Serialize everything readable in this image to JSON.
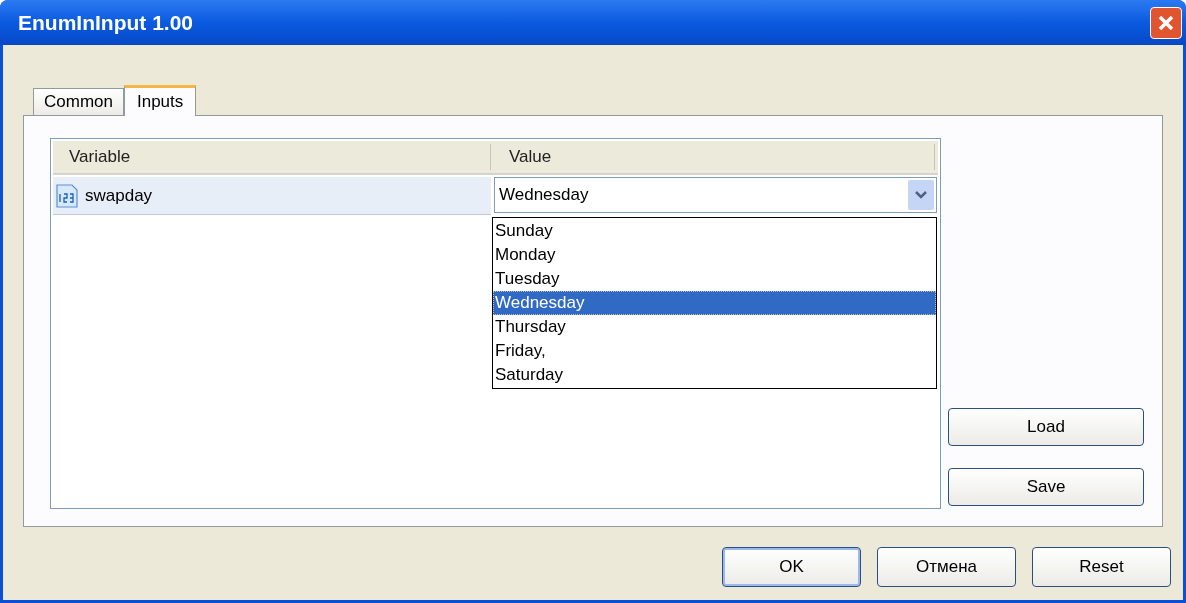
{
  "window": {
    "title": "EnumInInput 1.00"
  },
  "tabs": [
    {
      "label": "Common",
      "selected": false
    },
    {
      "label": "Inputs",
      "selected": true
    }
  ],
  "table": {
    "columns": [
      "Variable",
      "Value"
    ],
    "rows": [
      {
        "variable": "swapday",
        "value": "Wednesday",
        "expanded": true
      }
    ]
  },
  "dropdown": {
    "options": [
      {
        "label": "Sunday",
        "selected": false
      },
      {
        "label": "Monday",
        "selected": false
      },
      {
        "label": "Tuesday",
        "selected": false
      },
      {
        "label": "Wednesday",
        "selected": true
      },
      {
        "label": "Thursday",
        "selected": false
      },
      {
        "label": "Friday,",
        "selected": false
      },
      {
        "label": "Saturday",
        "selected": false
      }
    ]
  },
  "side_buttons": [
    "Load",
    "Save"
  ],
  "buttons": [
    "OK",
    "Отмена",
    "Reset"
  ]
}
